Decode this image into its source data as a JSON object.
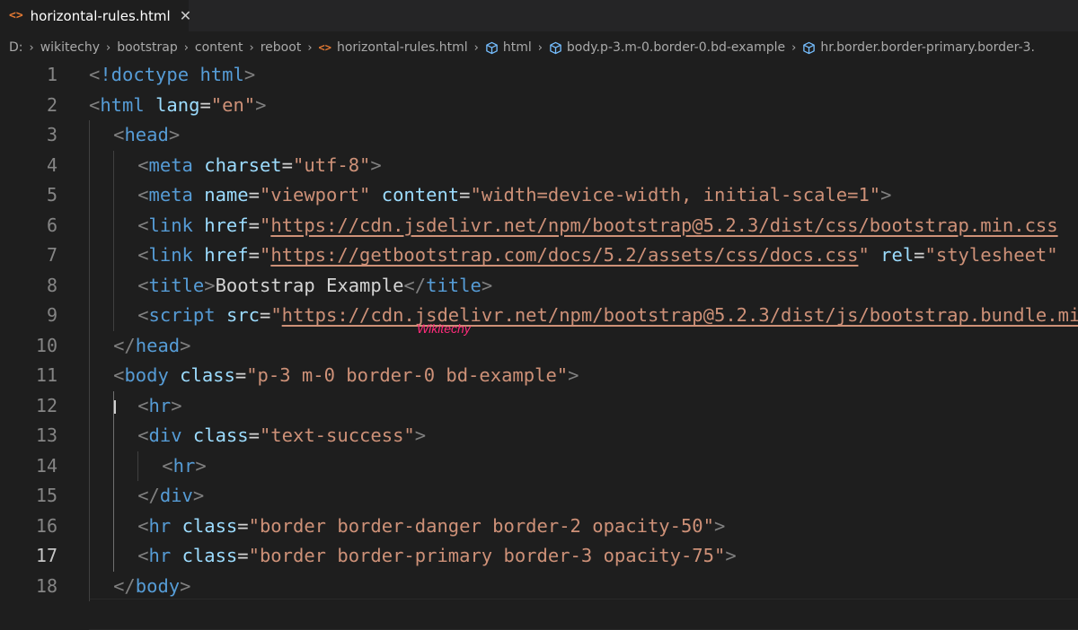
{
  "tab": {
    "icon": "<>",
    "label": "horizontal-rules.html",
    "close": "✕"
  },
  "breadcrumb": [
    {
      "label": "D:",
      "icon": ""
    },
    {
      "label": "wikitechy",
      "icon": ""
    },
    {
      "label": "bootstrap",
      "icon": ""
    },
    {
      "label": "content",
      "icon": ""
    },
    {
      "label": "reboot",
      "icon": ""
    },
    {
      "label": "horizontal-rules.html",
      "icon": "code"
    },
    {
      "label": "html",
      "icon": "cube"
    },
    {
      "label": "body.p-3.m-0.border-0.bd-example",
      "icon": "cube"
    },
    {
      "label": "hr.border.border-primary.border-3.",
      "icon": "cube"
    }
  ],
  "watermark": "Wikitechy",
  "active_line": 17,
  "lines": [
    {
      "n": "1",
      "indent": 0,
      "tokens": [
        [
          "punc",
          "<"
        ],
        [
          "tag",
          "!doctype"
        ],
        [
          "text",
          " "
        ],
        [
          "tag",
          "html"
        ],
        [
          "punc",
          ">"
        ]
      ]
    },
    {
      "n": "2",
      "indent": 0,
      "tokens": [
        [
          "punc",
          "<"
        ],
        [
          "tag",
          "html"
        ],
        [
          "text",
          " "
        ],
        [
          "attr",
          "lang"
        ],
        [
          "text",
          "="
        ],
        [
          "str",
          "\"en\""
        ],
        [
          "punc",
          ">"
        ]
      ]
    },
    {
      "n": "3",
      "indent": 1,
      "tokens": [
        [
          "punc",
          "<"
        ],
        [
          "tag",
          "head"
        ],
        [
          "punc",
          ">"
        ]
      ]
    },
    {
      "n": "4",
      "indent": 2,
      "tokens": [
        [
          "punc",
          "<"
        ],
        [
          "tag",
          "meta"
        ],
        [
          "text",
          " "
        ],
        [
          "attr",
          "charset"
        ],
        [
          "text",
          "="
        ],
        [
          "str",
          "\"utf-8\""
        ],
        [
          "punc",
          ">"
        ]
      ]
    },
    {
      "n": "5",
      "indent": 2,
      "tokens": [
        [
          "punc",
          "<"
        ],
        [
          "tag",
          "meta"
        ],
        [
          "text",
          " "
        ],
        [
          "attr",
          "name"
        ],
        [
          "text",
          "="
        ],
        [
          "str",
          "\"viewport\""
        ],
        [
          "text",
          " "
        ],
        [
          "attr",
          "content"
        ],
        [
          "text",
          "="
        ],
        [
          "str",
          "\"width=device-width, initial-scale=1\""
        ],
        [
          "punc",
          ">"
        ]
      ]
    },
    {
      "n": "6",
      "indent": 2,
      "tokens": [
        [
          "punc",
          "<"
        ],
        [
          "tag",
          "link"
        ],
        [
          "text",
          " "
        ],
        [
          "attr",
          "href"
        ],
        [
          "text",
          "="
        ],
        [
          "str",
          "\""
        ],
        [
          "link",
          "https://cdn.jsdelivr.net/npm/bootstrap@5.2.3/dist/css/bootstrap.min.css"
        ]
      ]
    },
    {
      "n": "7",
      "indent": 2,
      "tokens": [
        [
          "punc",
          "<"
        ],
        [
          "tag",
          "link"
        ],
        [
          "text",
          " "
        ],
        [
          "attr",
          "href"
        ],
        [
          "text",
          "="
        ],
        [
          "str",
          "\""
        ],
        [
          "link",
          "https://getbootstrap.com/docs/5.2/assets/css/docs.css"
        ],
        [
          "str",
          "\""
        ],
        [
          "text",
          " "
        ],
        [
          "attr",
          "rel"
        ],
        [
          "text",
          "="
        ],
        [
          "str",
          "\"stylesheet\""
        ]
      ]
    },
    {
      "n": "8",
      "indent": 2,
      "tokens": [
        [
          "punc",
          "<"
        ],
        [
          "tag",
          "title"
        ],
        [
          "punc",
          ">"
        ],
        [
          "text",
          "Bootstrap Example"
        ],
        [
          "punc",
          "</"
        ],
        [
          "tag",
          "title"
        ],
        [
          "punc",
          ">"
        ]
      ]
    },
    {
      "n": "9",
      "indent": 2,
      "tokens": [
        [
          "punc",
          "<"
        ],
        [
          "tag",
          "script"
        ],
        [
          "text",
          " "
        ],
        [
          "attr",
          "src"
        ],
        [
          "text",
          "="
        ],
        [
          "str",
          "\""
        ],
        [
          "link",
          "https://cdn.jsdelivr.net/npm/bootstrap@5.2.3/dist/js/bootstrap.bundle.min.js"
        ]
      ]
    },
    {
      "n": "10",
      "indent": 1,
      "tokens": [
        [
          "punc",
          "</"
        ],
        [
          "tag",
          "head"
        ],
        [
          "punc",
          ">"
        ]
      ]
    },
    {
      "n": "11",
      "indent": 1,
      "tokens": [
        [
          "punc",
          "<"
        ],
        [
          "tag",
          "body"
        ],
        [
          "text",
          " "
        ],
        [
          "attr",
          "class"
        ],
        [
          "text",
          "="
        ],
        [
          "str",
          "\"p-3 m-0 border-0 bd-example\""
        ],
        [
          "punc",
          ">"
        ]
      ]
    },
    {
      "n": "12",
      "indent": 2,
      "tokens": [
        [
          "punc",
          "<"
        ],
        [
          "tag",
          "hr"
        ],
        [
          "punc",
          ">"
        ]
      ]
    },
    {
      "n": "13",
      "indent": 2,
      "tokens": [
        [
          "punc",
          "<"
        ],
        [
          "tag",
          "div"
        ],
        [
          "text",
          " "
        ],
        [
          "attr",
          "class"
        ],
        [
          "text",
          "="
        ],
        [
          "str",
          "\"text-success\""
        ],
        [
          "punc",
          ">"
        ]
      ]
    },
    {
      "n": "14",
      "indent": 3,
      "tokens": [
        [
          "punc",
          "<"
        ],
        [
          "tag",
          "hr"
        ],
        [
          "punc",
          ">"
        ]
      ]
    },
    {
      "n": "15",
      "indent": 2,
      "tokens": [
        [
          "punc",
          "</"
        ],
        [
          "tag",
          "div"
        ],
        [
          "punc",
          ">"
        ]
      ]
    },
    {
      "n": "16",
      "indent": 2,
      "tokens": [
        [
          "punc",
          "<"
        ],
        [
          "tag",
          "hr"
        ],
        [
          "text",
          " "
        ],
        [
          "attr",
          "class"
        ],
        [
          "text",
          "="
        ],
        [
          "str",
          "\"border border-danger border-2 opacity-50\""
        ],
        [
          "punc",
          ">"
        ]
      ]
    },
    {
      "n": "17",
      "indent": 2,
      "tokens": [
        [
          "punc",
          "<"
        ],
        [
          "tag",
          "hr"
        ],
        [
          "text",
          " "
        ],
        [
          "attr",
          "class"
        ],
        [
          "text",
          "="
        ],
        [
          "str",
          "\"border border-primary border-3 opacity-75\""
        ],
        [
          "punc",
          ">"
        ]
      ]
    },
    {
      "n": "18",
      "indent": 1,
      "tokens": [
        [
          "punc",
          "</"
        ],
        [
          "tag",
          "body"
        ],
        [
          "punc",
          ">"
        ]
      ]
    }
  ]
}
